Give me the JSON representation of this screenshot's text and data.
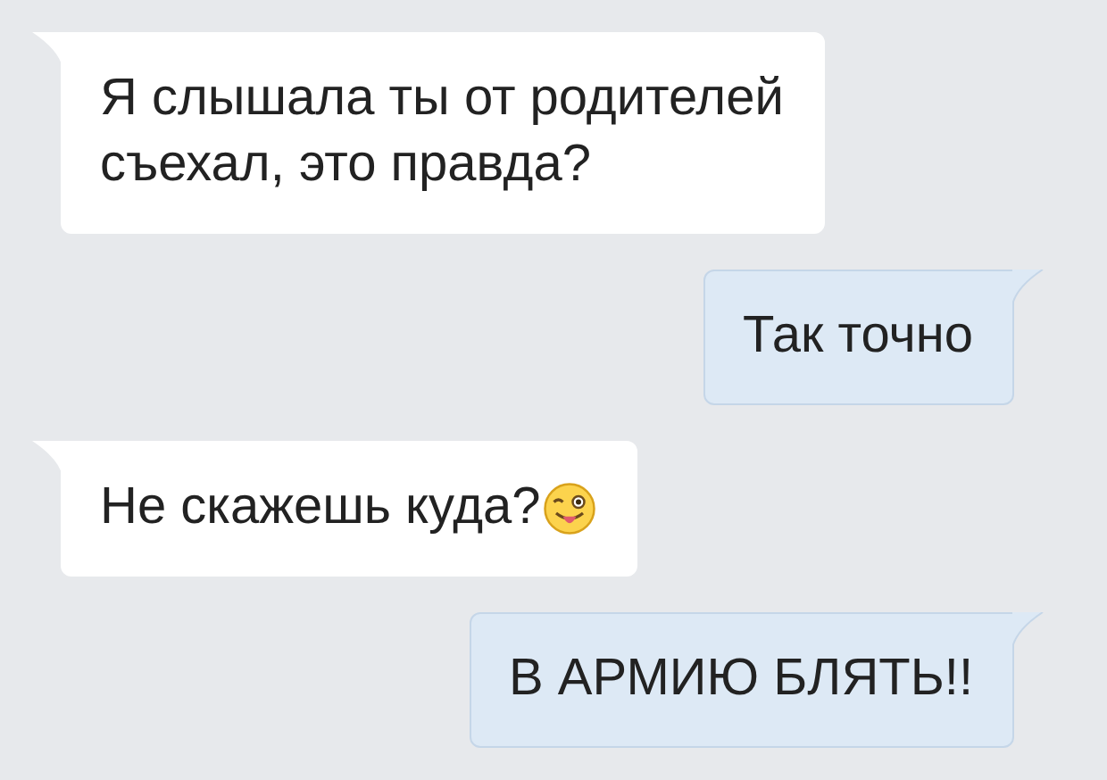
{
  "messages": [
    {
      "outgoing": false,
      "text": "Я слышала ты от родителей\nсъехал, это правда?",
      "has_emoji": false
    },
    {
      "outgoing": true,
      "text": "Так точно",
      "has_emoji": false
    },
    {
      "outgoing": false,
      "text": "Не скажешь куда?",
      "has_emoji": true
    },
    {
      "outgoing": true,
      "text": "В АРМИЮ БЛЯТЬ!!",
      "has_emoji": false
    }
  ]
}
